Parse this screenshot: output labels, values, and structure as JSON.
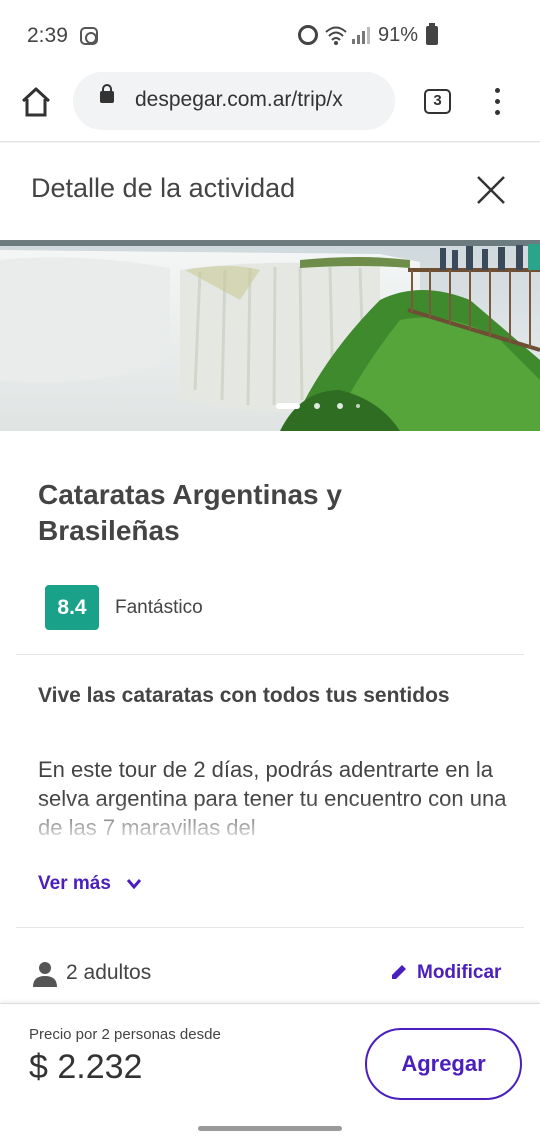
{
  "status_bar": {
    "time": "2:39",
    "battery_pct": "91%",
    "icons": [
      "instagram-icon",
      "alarm-icon",
      "wifi-icon",
      "signal-icon",
      "battery-icon"
    ]
  },
  "browser": {
    "url": "despegar.com.ar/trip/x",
    "tab_count": "3",
    "icons": [
      "home-icon",
      "lock-icon",
      "menu-icon"
    ]
  },
  "header": {
    "title": "Detalle de la actividad",
    "close_icon": "close-icon"
  },
  "gallery": {
    "image_alt": "waterfall photo",
    "slide_count": 4,
    "active_slide": 1
  },
  "activity": {
    "title": "Cataratas Argentinas y Brasileñas",
    "score": "8.4",
    "score_label": "Fantástico",
    "subtitle": "Vive las cataratas con todos tus sentidos",
    "description": "En este tour de 2 días, podrás adentrarte en la selva argentina para tener tu encuentro con una de las 7 maravillas del",
    "see_more": "Ver más"
  },
  "travelers": {
    "label": "2 adultos",
    "modify": "Modificar"
  },
  "footer": {
    "price_caption": "Precio por 2 personas desde",
    "price": "$ 2.232",
    "add_button": "Agregar"
  },
  "colors": {
    "accent": "#4a1fbd",
    "score_badge": "#1aa18a"
  }
}
